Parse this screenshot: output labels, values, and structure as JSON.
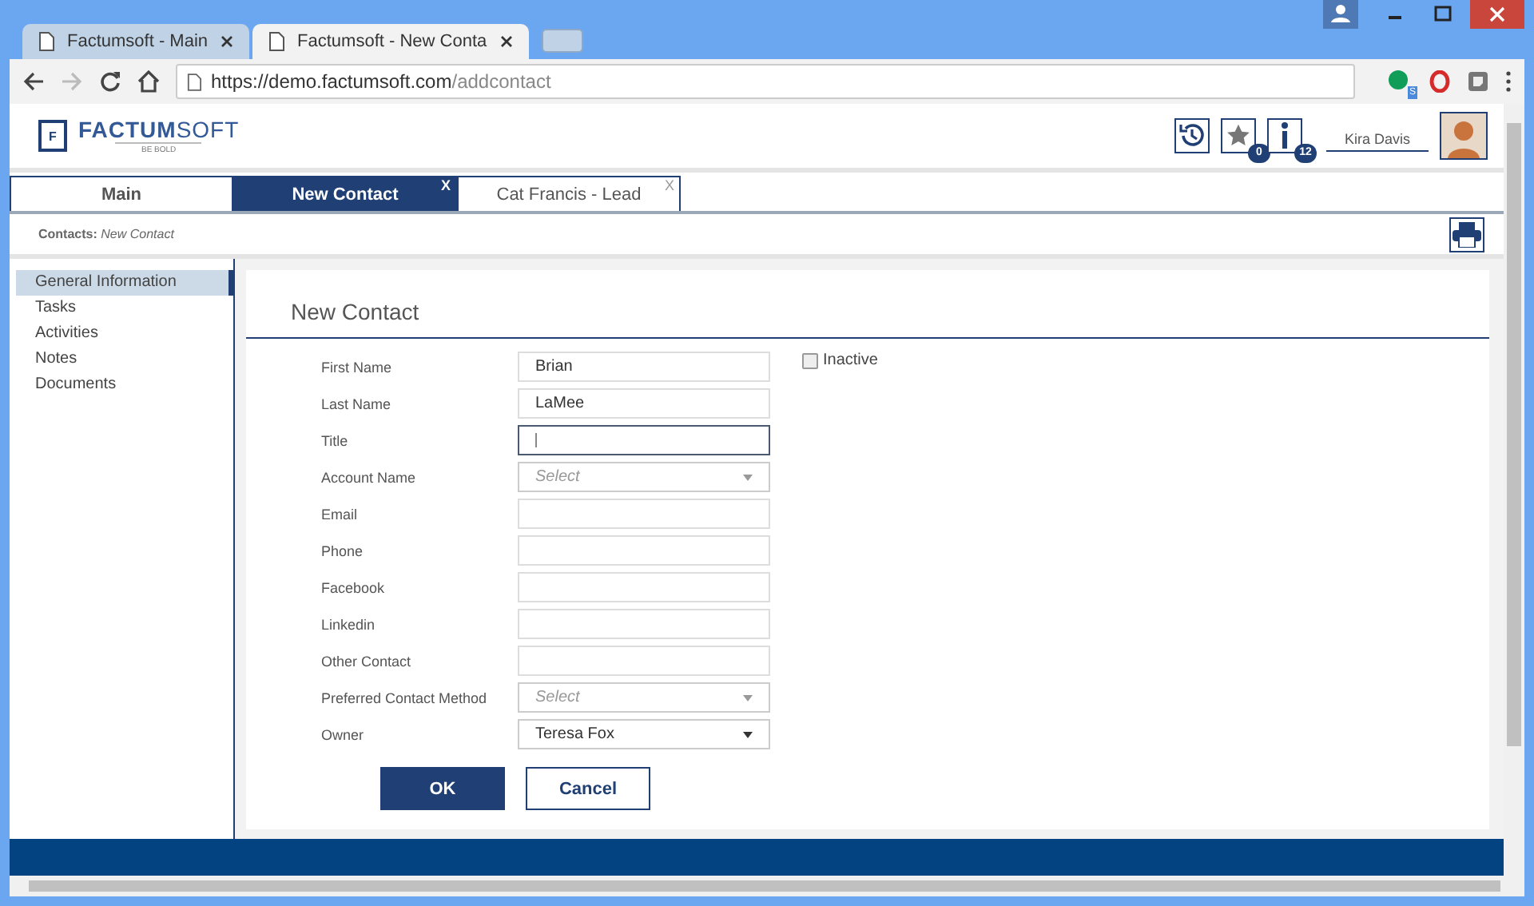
{
  "browser": {
    "tabs": [
      {
        "title": "Factumsoft - Main",
        "selected": false
      },
      {
        "title": "Factumsoft - New Conta",
        "selected": true
      }
    ],
    "url": {
      "host": "https://demo.factumsoft.com",
      "path": "/addcontact"
    },
    "extension_badge": "S"
  },
  "header": {
    "logo": {
      "mark": "F",
      "name": "**FACTUM**SOFT",
      "tagline": "BE BOLD"
    },
    "favorites_count": "0",
    "notifications_count": "12",
    "user": "Kira Davis"
  },
  "app_tabs": [
    {
      "label": "Main",
      "selected": false
    },
    {
      "label": "New Contact",
      "selected": true,
      "close": "X"
    },
    {
      "label": "Cat Francis - Lead",
      "selected": false,
      "close": "X"
    }
  ],
  "breadcrumb": {
    "section": "Contacts:",
    "page": "New Contact"
  },
  "sidebar": {
    "items": [
      {
        "label": "General Information",
        "selected": true
      },
      {
        "label": "Tasks",
        "selected": false
      },
      {
        "label": "Activities",
        "selected": false
      },
      {
        "label": "Notes",
        "selected": false
      },
      {
        "label": "Documents",
        "selected": false
      }
    ]
  },
  "form": {
    "title": "New Contact",
    "inactive": {
      "label": "Inactive",
      "checked": false
    },
    "fields": [
      {
        "label": "First Name",
        "kind": "text",
        "value": "Brian",
        "focused": false
      },
      {
        "label": "Last Name",
        "kind": "text",
        "value": "LaMee",
        "focused": false
      },
      {
        "label": "Title",
        "kind": "text",
        "focused": true
      },
      {
        "label": "Account Name",
        "kind": "select",
        "placeholder": "Select",
        "focused": false
      },
      {
        "label": "Email",
        "kind": "text",
        "focused": false
      },
      {
        "label": "Phone",
        "kind": "text",
        "focused": false
      },
      {
        "label": "Facebook",
        "kind": "text",
        "focused": false
      },
      {
        "label": "Linkedin",
        "kind": "text",
        "focused": false
      },
      {
        "label": "Other Contact",
        "kind": "text",
        "focused": false
      },
      {
        "label": "Preferred Contact Method",
        "kind": "select",
        "placeholder": "Select",
        "focused": false
      },
      {
        "label": "Owner",
        "kind": "select",
        "value": "Teresa Fox",
        "focused": false
      }
    ],
    "buttons": [
      {
        "label": "OK",
        "primary": true
      },
      {
        "label": "Cancel",
        "primary": false
      }
    ]
  }
}
